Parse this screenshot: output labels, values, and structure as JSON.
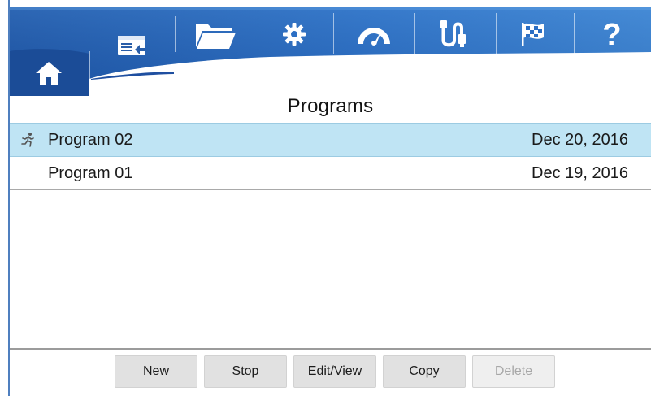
{
  "header": {
    "tabs": [
      {
        "id": "home",
        "icon": "home-icon"
      },
      {
        "id": "programs",
        "icon": "program-list-icon",
        "active": true
      },
      {
        "id": "files",
        "icon": "folder-icon"
      },
      {
        "id": "settings",
        "icon": "gear-icon"
      },
      {
        "id": "gauge",
        "icon": "gauge-icon"
      },
      {
        "id": "usb",
        "icon": "usb-cable-icon"
      },
      {
        "id": "finish",
        "icon": "checkered-flag-icon"
      },
      {
        "id": "help",
        "icon": "help-icon"
      }
    ],
    "help_symbol": "?"
  },
  "page": {
    "title": "Programs"
  },
  "programs": {
    "items": [
      {
        "name": "Program 02",
        "date": "Dec 20, 2016",
        "running": true,
        "selected": true
      },
      {
        "name": "Program 01",
        "date": "Dec 19, 2016",
        "running": false,
        "selected": false
      }
    ]
  },
  "toolbar": {
    "new_label": "New",
    "stop_label": "Stop",
    "edit_label": "Edit/View",
    "copy_label": "Copy",
    "delete_label": "Delete",
    "delete_disabled": true
  },
  "colors": {
    "header_dark": "#1f4f9a",
    "header_light": "#4e8fd6",
    "selected_row": "#bfe4f4",
    "active_underline": "#1f4fa0"
  }
}
